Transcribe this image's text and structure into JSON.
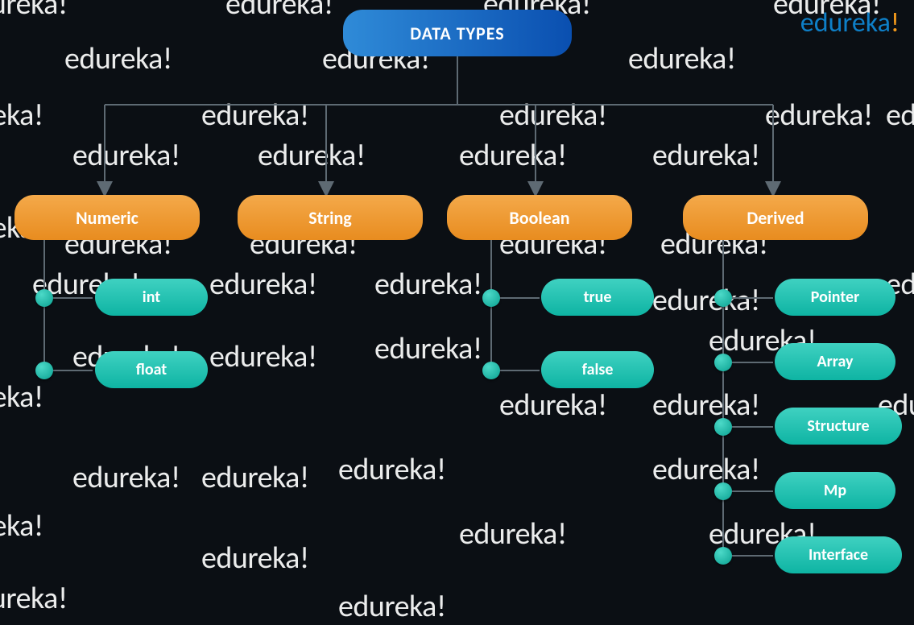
{
  "watermark_text": "edureka!",
  "logo_primary": "edureka",
  "logo_bang": "!",
  "root": "DATA TYPES",
  "categories": {
    "numeric": "Numeric",
    "string": "String",
    "boolean": "Boolean",
    "derived": "Derived"
  },
  "leaves": {
    "int": "int",
    "float": "float",
    "true": "true",
    "false": "false",
    "pointer": "Pointer",
    "array": "Array",
    "structure": "Structure",
    "mp": "Mp",
    "interface": "Interface"
  },
  "watermark_positions": [
    [
      -50,
      -18
    ],
    [
      280,
      -18
    ],
    [
      600,
      -18
    ],
    [
      960,
      -18
    ],
    [
      80,
      50
    ],
    [
      400,
      50
    ],
    [
      780,
      50
    ],
    [
      -80,
      120
    ],
    [
      250,
      120
    ],
    [
      620,
      120
    ],
    [
      950,
      120
    ],
    [
      1100,
      120
    ],
    [
      90,
      170
    ],
    [
      320,
      170
    ],
    [
      570,
      170
    ],
    [
      810,
      170
    ],
    [
      -80,
      260
    ],
    [
      80,
      280
    ],
    [
      310,
      280
    ],
    [
      620,
      280
    ],
    [
      820,
      280
    ],
    [
      40,
      330
    ],
    [
      260,
      330
    ],
    [
      465,
      330
    ],
    [
      810,
      350
    ],
    [
      1100,
      330
    ],
    [
      90,
      420
    ],
    [
      260,
      420
    ],
    [
      465,
      410
    ],
    [
      880,
      400
    ],
    [
      -80,
      470
    ],
    [
      620,
      480
    ],
    [
      810,
      480
    ],
    [
      1090,
      480
    ],
    [
      90,
      570
    ],
    [
      250,
      570
    ],
    [
      420,
      560
    ],
    [
      810,
      560
    ],
    [
      -80,
      630
    ],
    [
      250,
      670
    ],
    [
      570,
      640
    ],
    [
      880,
      640
    ],
    [
      -50,
      720
    ],
    [
      420,
      730
    ]
  ]
}
